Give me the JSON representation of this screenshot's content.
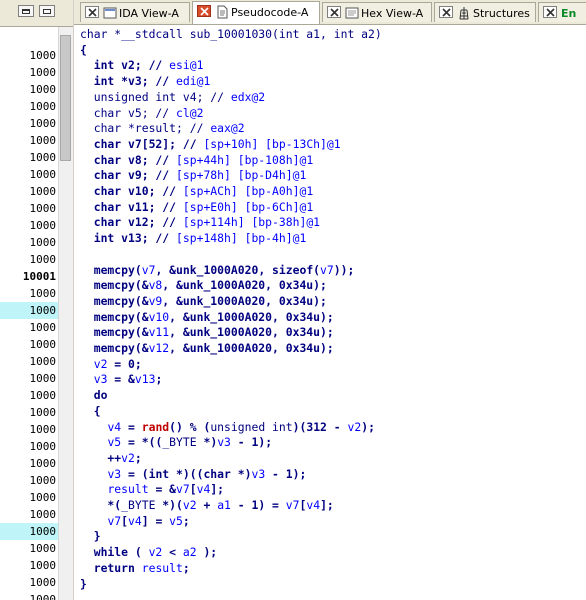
{
  "colors": {
    "addr_highlight": "#bff5f8",
    "keyword": "#000080",
    "variable": "#0000ff",
    "call": "#c00000",
    "tab_bar": "#ece9d8"
  },
  "left_pane": {
    "addresses": [
      {
        "text": "1000",
        "highlight": false,
        "bold": false
      },
      {
        "text": "1000",
        "highlight": false,
        "bold": false
      },
      {
        "text": "1000",
        "highlight": false,
        "bold": false
      },
      {
        "text": "1000",
        "highlight": false,
        "bold": false
      },
      {
        "text": "1000",
        "highlight": false,
        "bold": false
      },
      {
        "text": "1000",
        "highlight": false,
        "bold": false
      },
      {
        "text": "1000",
        "highlight": false,
        "bold": false
      },
      {
        "text": "1000",
        "highlight": false,
        "bold": false
      },
      {
        "text": "1000",
        "highlight": false,
        "bold": false
      },
      {
        "text": "1000",
        "highlight": false,
        "bold": false
      },
      {
        "text": "1000",
        "highlight": false,
        "bold": false
      },
      {
        "text": "1000",
        "highlight": false,
        "bold": false
      },
      {
        "text": "1000",
        "highlight": false,
        "bold": false
      },
      {
        "text": "10001",
        "highlight": false,
        "bold": true
      },
      {
        "text": "1000",
        "highlight": false,
        "bold": false
      },
      {
        "text": "1000",
        "highlight": true,
        "bold": false
      },
      {
        "text": "1000",
        "highlight": false,
        "bold": false
      },
      {
        "text": "1000",
        "highlight": false,
        "bold": false
      },
      {
        "text": "1000",
        "highlight": false,
        "bold": false
      },
      {
        "text": "1000",
        "highlight": false,
        "bold": false
      },
      {
        "text": "1000",
        "highlight": false,
        "bold": false
      },
      {
        "text": "1000",
        "highlight": false,
        "bold": false
      },
      {
        "text": "1000",
        "highlight": false,
        "bold": false
      },
      {
        "text": "1000",
        "highlight": false,
        "bold": false
      },
      {
        "text": "1000",
        "highlight": false,
        "bold": false
      },
      {
        "text": "1000",
        "highlight": false,
        "bold": false
      },
      {
        "text": "1000",
        "highlight": false,
        "bold": false
      },
      {
        "text": "1000",
        "highlight": false,
        "bold": false
      },
      {
        "text": "1000",
        "highlight": true,
        "bold": false
      },
      {
        "text": "1000",
        "highlight": false,
        "bold": false
      },
      {
        "text": "1000",
        "highlight": false,
        "bold": false
      },
      {
        "text": "1000",
        "highlight": false,
        "bold": false
      },
      {
        "text": "1000",
        "highlight": false,
        "bold": false
      },
      {
        "text": "1000",
        "highlight": false,
        "bold": false
      }
    ]
  },
  "tabs": [
    {
      "label": "IDA View-A",
      "icon": "ida-view-icon",
      "active": false,
      "close_style": "normal"
    },
    {
      "label": "Pseudocode-A",
      "icon": "pseudocode-icon",
      "active": true,
      "close_style": "red"
    },
    {
      "label": "Hex View-A",
      "icon": "hex-view-icon",
      "active": false,
      "close_style": "normal"
    },
    {
      "label": "Structures",
      "icon": "structures-icon",
      "active": false,
      "close_style": "normal"
    },
    {
      "label": "En",
      "icon": "enums-icon",
      "active": false,
      "close_style": "normal"
    }
  ],
  "code": {
    "lines": [
      [
        {
          "t": "char *__stdcall sub_10001030(int a1, int a2)",
          "c": "fn"
        }
      ],
      [
        {
          "t": "{",
          "c": "kw"
        }
      ],
      [
        {
          "t": "  int v2; // ",
          "c": "kw"
        },
        {
          "t": "esi@1",
          "c": "cmt"
        }
      ],
      [
        {
          "t": "  int *v3; // ",
          "c": "kw"
        },
        {
          "t": "edi@1",
          "c": "cmt"
        }
      ],
      [
        {
          "t": "  unsigned int v4; // ",
          "c": "fn"
        },
        {
          "t": "edx@2",
          "c": "cmt"
        }
      ],
      [
        {
          "t": "  char v5; // ",
          "c": "fn"
        },
        {
          "t": "cl@2",
          "c": "cmt"
        }
      ],
      [
        {
          "t": "  char *result; // ",
          "c": "fn"
        },
        {
          "t": "eax@2",
          "c": "cmt"
        }
      ],
      [
        {
          "t": "  char v7[52]; // ",
          "c": "kw"
        },
        {
          "t": "[sp+10h] [bp-13Ch]@1",
          "c": "cmt"
        }
      ],
      [
        {
          "t": "  char v8; // ",
          "c": "kw"
        },
        {
          "t": "[sp+44h] [bp-108h]@1",
          "c": "cmt"
        }
      ],
      [
        {
          "t": "  char v9; // ",
          "c": "kw"
        },
        {
          "t": "[sp+78h] [bp-D4h]@1",
          "c": "cmt"
        }
      ],
      [
        {
          "t": "  char v10; // ",
          "c": "kw"
        },
        {
          "t": "[sp+ACh] [bp-A0h]@1",
          "c": "cmt"
        }
      ],
      [
        {
          "t": "  char v11; // ",
          "c": "kw"
        },
        {
          "t": "[sp+E0h] [bp-6Ch]@1",
          "c": "cmt"
        }
      ],
      [
        {
          "t": "  char v12; // ",
          "c": "kw"
        },
        {
          "t": "[sp+114h] [bp-38h]@1",
          "c": "cmt"
        }
      ],
      [
        {
          "t": "  int v13; // ",
          "c": "kw"
        },
        {
          "t": "[sp+148h] [bp-4h]@1",
          "c": "cmt"
        }
      ],
      [
        {
          "t": "",
          "c": "kw"
        }
      ],
      [
        {
          "t": "  memcpy(",
          "c": "kw"
        },
        {
          "t": "v7",
          "c": "var"
        },
        {
          "t": ", &unk_1000A020, sizeof(",
          "c": "kw"
        },
        {
          "t": "v7",
          "c": "var"
        },
        {
          "t": "));",
          "c": "kw"
        }
      ],
      [
        {
          "t": "  memcpy(&",
          "c": "kw"
        },
        {
          "t": "v8",
          "c": "var"
        },
        {
          "t": ", &unk_1000A020, 0x34u);",
          "c": "kw"
        }
      ],
      [
        {
          "t": "  memcpy(&",
          "c": "kw"
        },
        {
          "t": "v9",
          "c": "var"
        },
        {
          "t": ", &unk_1000A020, 0x34u);",
          "c": "kw"
        }
      ],
      [
        {
          "t": "  memcpy(&",
          "c": "kw"
        },
        {
          "t": "v10",
          "c": "var"
        },
        {
          "t": ", &unk_1000A020, 0x34u);",
          "c": "kw"
        }
      ],
      [
        {
          "t": "  memcpy(&",
          "c": "kw"
        },
        {
          "t": "v11",
          "c": "var"
        },
        {
          "t": ", &unk_1000A020, 0x34u);",
          "c": "kw"
        }
      ],
      [
        {
          "t": "  memcpy(&",
          "c": "kw"
        },
        {
          "t": "v12",
          "c": "var"
        },
        {
          "t": ", &unk_1000A020, 0x34u);",
          "c": "kw"
        }
      ],
      [
        {
          "t": "  ",
          "c": "kw"
        },
        {
          "t": "v2",
          "c": "var"
        },
        {
          "t": " = 0;",
          "c": "kw"
        }
      ],
      [
        {
          "t": "  ",
          "c": "kw"
        },
        {
          "t": "v3",
          "c": "var"
        },
        {
          "t": " = &",
          "c": "kw"
        },
        {
          "t": "v13",
          "c": "var"
        },
        {
          "t": ";",
          "c": "kw"
        }
      ],
      [
        {
          "t": "  do",
          "c": "kw"
        }
      ],
      [
        {
          "t": "  {",
          "c": "kw"
        }
      ],
      [
        {
          "t": "    ",
          "c": "kw"
        },
        {
          "t": "v4",
          "c": "var"
        },
        {
          "t": " = ",
          "c": "kw"
        },
        {
          "t": "rand",
          "c": "call"
        },
        {
          "t": "() % (",
          "c": "kw"
        },
        {
          "t": "unsigned int",
          "c": "fn"
        },
        {
          "t": ")(312 - ",
          "c": "kw"
        },
        {
          "t": "v2",
          "c": "var"
        },
        {
          "t": ");",
          "c": "kw"
        }
      ],
      [
        {
          "t": "    ",
          "c": "kw"
        },
        {
          "t": "v5",
          "c": "var"
        },
        {
          "t": " = *((",
          "c": "kw"
        },
        {
          "t": "_BYTE",
          "c": "fn"
        },
        {
          "t": " *)",
          "c": "kw"
        },
        {
          "t": "v3",
          "c": "var"
        },
        {
          "t": " - 1);",
          "c": "kw"
        }
      ],
      [
        {
          "t": "    ++",
          "c": "kw"
        },
        {
          "t": "v2",
          "c": "var"
        },
        {
          "t": ";",
          "c": "kw"
        }
      ],
      [
        {
          "t": "    ",
          "c": "kw"
        },
        {
          "t": "v3",
          "c": "var"
        },
        {
          "t": " = (int *)((char *)",
          "c": "kw"
        },
        {
          "t": "v3",
          "c": "var"
        },
        {
          "t": " - 1);",
          "c": "kw"
        }
      ],
      [
        {
          "t": "    ",
          "c": "kw"
        },
        {
          "t": "result",
          "c": "var"
        },
        {
          "t": " = &",
          "c": "kw"
        },
        {
          "t": "v7",
          "c": "var"
        },
        {
          "t": "[",
          "c": "kw"
        },
        {
          "t": "v4",
          "c": "var"
        },
        {
          "t": "];",
          "c": "kw"
        }
      ],
      [
        {
          "t": "    *(",
          "c": "kw"
        },
        {
          "t": "_BYTE",
          "c": "fn"
        },
        {
          "t": " *)(",
          "c": "kw"
        },
        {
          "t": "v2",
          "c": "var"
        },
        {
          "t": " + ",
          "c": "kw"
        },
        {
          "t": "a1",
          "c": "var"
        },
        {
          "t": " - 1) = ",
          "c": "kw"
        },
        {
          "t": "v7",
          "c": "var"
        },
        {
          "t": "[",
          "c": "kw"
        },
        {
          "t": "v4",
          "c": "var"
        },
        {
          "t": "];",
          "c": "kw"
        }
      ],
      [
        {
          "t": "    ",
          "c": "kw"
        },
        {
          "t": "v7",
          "c": "var"
        },
        {
          "t": "[",
          "c": "kw"
        },
        {
          "t": "v4",
          "c": "var"
        },
        {
          "t": "] = ",
          "c": "kw"
        },
        {
          "t": "v5",
          "c": "var"
        },
        {
          "t": ";",
          "c": "kw"
        }
      ],
      [
        {
          "t": "  }",
          "c": "kw"
        }
      ],
      [
        {
          "t": "  while ( ",
          "c": "kw"
        },
        {
          "t": "v2",
          "c": "var"
        },
        {
          "t": " < ",
          "c": "kw"
        },
        {
          "t": "a2",
          "c": "var"
        },
        {
          "t": " );",
          "c": "kw"
        }
      ],
      [
        {
          "t": "  return ",
          "c": "kw"
        },
        {
          "t": "result",
          "c": "var"
        },
        {
          "t": ";",
          "c": "kw"
        }
      ],
      [
        {
          "t": "}",
          "c": "kw"
        }
      ]
    ]
  }
}
